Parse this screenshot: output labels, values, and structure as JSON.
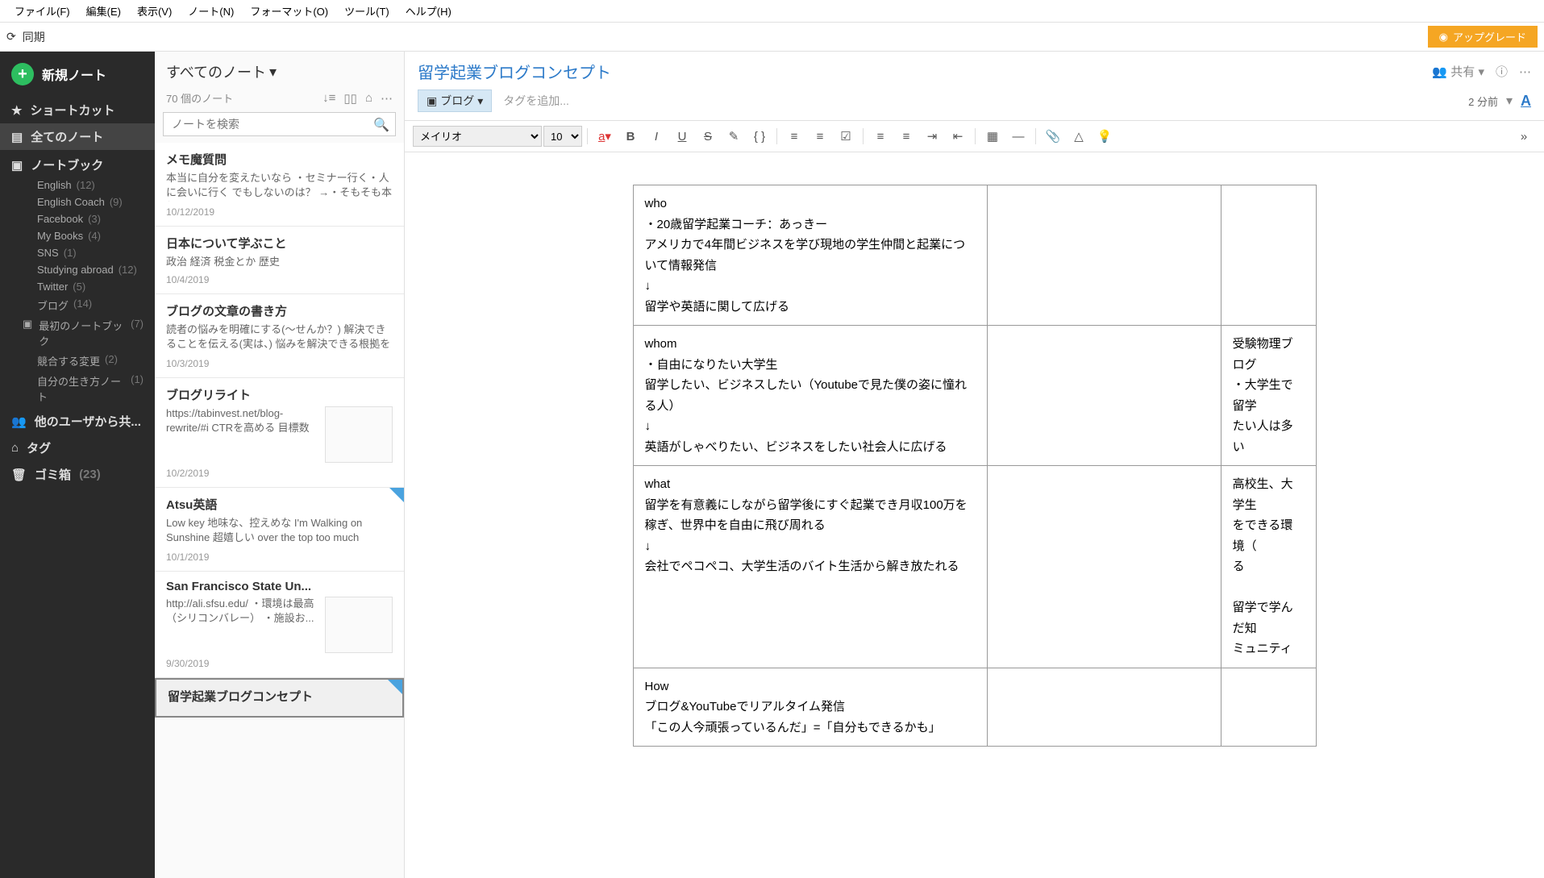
{
  "menu": [
    "ファイル(F)",
    "編集(E)",
    "表示(V)",
    "ノート(N)",
    "フォーマット(O)",
    "ツール(T)",
    "ヘルプ(H)"
  ],
  "sync": "同期",
  "upgrade": "アップグレード",
  "newNote": "新規ノート",
  "sidebar": {
    "shortcut": "ショートカット",
    "allNotes": "全てのノート",
    "notebook": "ノートブック",
    "sharedUsers": "他のユーザから共...",
    "tags": "タグ",
    "trash": "ゴミ箱",
    "trashCount": "(23)",
    "notebooks": [
      {
        "name": "English",
        "count": "(12)"
      },
      {
        "name": "English Coach",
        "count": "(9)"
      },
      {
        "name": "Facebook",
        "count": "(3)"
      },
      {
        "name": "My Books",
        "count": "(4)"
      },
      {
        "name": "SNS",
        "count": "(1)"
      },
      {
        "name": "Studying abroad",
        "count": "(12)"
      },
      {
        "name": "Twitter",
        "count": "(5)"
      },
      {
        "name": "ブログ",
        "count": "(14)"
      },
      {
        "name": "最初のノートブック",
        "count": "(7)"
      },
      {
        "name": "競合する変更",
        "count": "(2)"
      },
      {
        "name": "自分の生き方ノート",
        "count": "(1)"
      }
    ]
  },
  "notelist": {
    "header": "すべてのノート",
    "count": "70 個のノート",
    "searchPlaceholder": "ノートを検索",
    "notes": [
      {
        "title": "メモ魔質問",
        "excerpt": "本当に自分を変えたいなら ・セミナー行く・人に会いに行く でもしないのは？ →・そもそも本気じゃな...",
        "date": "10/12/2019",
        "thumb": false,
        "corner": false
      },
      {
        "title": "日本について学ぶこと",
        "excerpt": "政治 経済 税金とか 歴史",
        "date": "10/4/2019",
        "thumb": false,
        "corner": false
      },
      {
        "title": "ブログの文章の書き方",
        "excerpt": "読者の悩みを明確にする(〜せんか？) 解決できることを伝える(実は、) 悩みを解決できる根拠を示...",
        "date": "10/3/2019",
        "thumb": false,
        "corner": false
      },
      {
        "title": "ブログリライト",
        "excerpt": "https://tabinvest.net/blog-rewrite/#i CTRを高める 目標数値を...",
        "date": "10/2/2019",
        "thumb": true,
        "corner": false
      },
      {
        "title": "Atsu英語",
        "excerpt": "Low key 地味な、控えめな I'm Walking on Sunshine 超嬉しい over the top too much cryst...",
        "date": "10/1/2019",
        "thumb": false,
        "corner": true
      },
      {
        "title": "San Francisco State Un...",
        "excerpt": "http://ali.sfsu.edu/ ・環境は最高（シリコンバレー） ・施設お...",
        "date": "9/30/2019",
        "thumb": true,
        "corner": false
      },
      {
        "title": "留学起業ブログコンセプト",
        "excerpt": "",
        "date": "",
        "thumb": false,
        "corner": true
      }
    ]
  },
  "editor": {
    "title": "留学起業ブログコンセプト",
    "share": "共有",
    "tagChip": "ブログ",
    "addTag": "タグを追加...",
    "time": "2 分前",
    "font": "メイリオ",
    "size": "10",
    "table": [
      [
        "who\n・20歳留学起業コーチ：あっきー\nアメリカで4年間ビジネスを学び現地の学生仲間と起業について情報発信\n↓\n留学や英語に関して広げる",
        "",
        ""
      ],
      [
        "whom\n・自由になりたい大学生\n留学したい、ビジネスしたい（Youtubeで見た僕の姿に憧れる人）\n↓\n英語がしゃべりたい、ビジネスをしたい社会人に広げる",
        "",
        "受験物理ブログ\n・大学生で留学\nたい人は多い"
      ],
      [
        "what\n留学を有意義にしながら留学後にすぐ起業でき月収100万を稼ぎ、世界中を自由に飛び周れる\n↓\n会社でペコペコ、大学生活のバイト生活から解き放たれる",
        "",
        "高校生、大学生\nをできる環境（\nる\n\n留学で学んだ知\nミュニティ"
      ],
      [
        "How\nブログ&YouTubeでリアルタイム発信\n「この人今頑張っているんだ」=「自分もできるかも」",
        "",
        ""
      ]
    ]
  }
}
